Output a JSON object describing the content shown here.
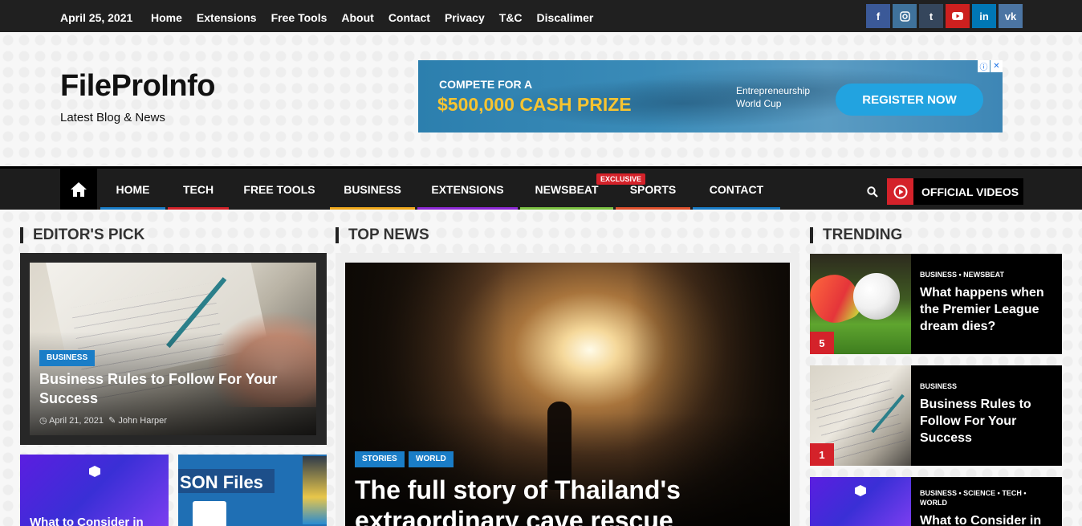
{
  "topbar": {
    "date": "April 25, 2021",
    "links": [
      "Home",
      "Extensions",
      "Free Tools",
      "About",
      "Contact",
      "Privacy",
      "T&C",
      "Discalimer"
    ],
    "social": [
      {
        "icon": "facebook-icon",
        "glyph": "f",
        "color": "#3b5998"
      },
      {
        "icon": "instagram-icon",
        "glyph": "◎",
        "color": "#3f729b"
      },
      {
        "icon": "tumblr-icon",
        "glyph": "t",
        "color": "#35465c"
      },
      {
        "icon": "youtube-icon",
        "glyph": "▶",
        "color": "#cd201f"
      },
      {
        "icon": "linkedin-icon",
        "glyph": "in",
        "color": "#0077b5"
      },
      {
        "icon": "vk-icon",
        "glyph": "vk",
        "color": "#4c75a3"
      }
    ]
  },
  "header": {
    "logo": "FileProInfo",
    "tagline": "Latest Blog & News",
    "ad": {
      "line1": "COMPETE FOR A",
      "line2": "$500,000 CASH PRIZE",
      "line3": "Entrepreneurship World Cup",
      "cta": "REGISTER NOW"
    }
  },
  "nav": {
    "items": [
      {
        "label": "HOME",
        "color": "#1a7dc7"
      },
      {
        "label": "TECH",
        "color": "#d4222a"
      },
      {
        "label": "FREE TOOLS",
        "color": "#1d1d1d"
      },
      {
        "label": "BUSINESS",
        "color": "#f0a91d"
      },
      {
        "label": "EXTENSIONS",
        "color": "#8e2ad6"
      },
      {
        "label": "NEWSBEAT",
        "color": "#7cc242"
      },
      {
        "label": "SPORTS",
        "color": "#e0522e"
      },
      {
        "label": "CONTACT",
        "color": "#1a7dc7"
      }
    ],
    "exclusive": "EXCLUSIVE",
    "videos": "OFFICIAL VIDEOS"
  },
  "editors_pick": {
    "heading": "EDITOR'S PICK",
    "main": {
      "category": "BUSINESS",
      "title": "Business Rules to Follow For Your Success",
      "date": "April 21, 2021",
      "author": "John Harper"
    },
    "thumb1_title": "What to Consider in",
    "thumb2_text": "SON Files"
  },
  "top_news": {
    "heading": "TOP NEWS",
    "categories": [
      "STORIES",
      "WORLD"
    ],
    "title": "The full story of Thailand's extraordinary cave rescue"
  },
  "trending": {
    "heading": "TRENDING",
    "items": [
      {
        "cats": "BUSINESS  •  NEWSBEAT",
        "title": "What happens when the Premier League dream dies?",
        "num": "5"
      },
      {
        "cats": "BUSINESS",
        "title": "Business Rules to Follow For Your Success",
        "num": "1"
      },
      {
        "cats": "BUSINESS  •  SCIENCE  •  TECH  •  WORLD",
        "title": "What to Consider in",
        "num": ""
      }
    ]
  }
}
